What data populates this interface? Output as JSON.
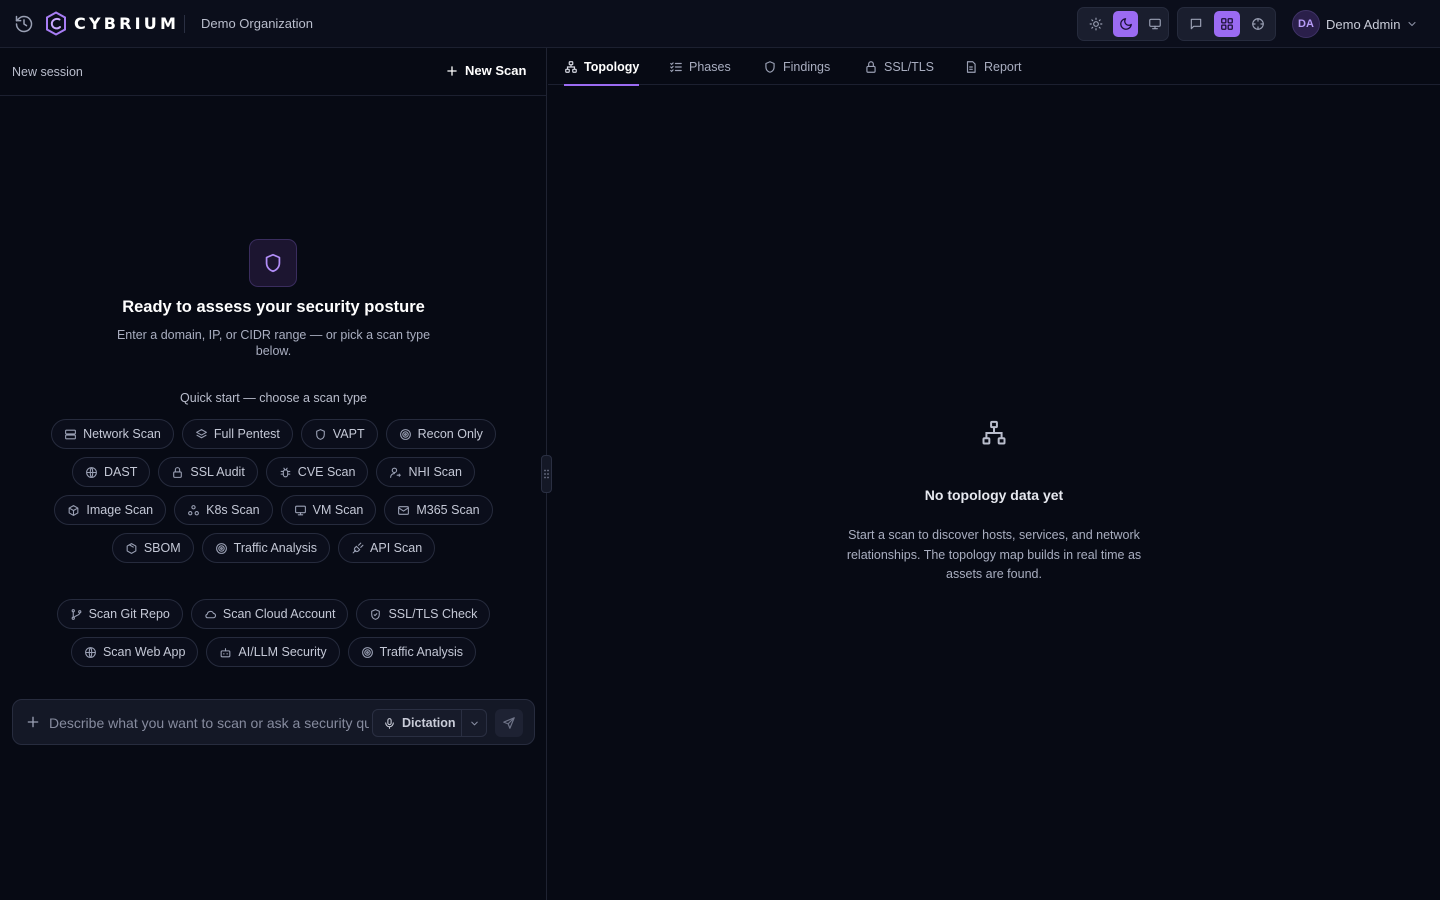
{
  "app": {
    "logo_text": "CYBRIUM",
    "organization": "Demo Organization"
  },
  "colors": {
    "accent": "#9b6bf2",
    "background": "#070a14",
    "panel": "#0b0e1b"
  },
  "header": {
    "history_icon": "history-icon",
    "theme_buttons": [
      {
        "icon": "sun-icon",
        "active": false
      },
      {
        "icon": "moon-icon",
        "active": true
      },
      {
        "icon": "monitor-icon",
        "active": false
      }
    ],
    "view_buttons": [
      {
        "icon": "chat-icon",
        "active": false
      },
      {
        "icon": "grid-icon",
        "active": true
      },
      {
        "icon": "crosshair-icon",
        "active": false
      }
    ],
    "user": {
      "initials": "DA",
      "name": "Demo Admin"
    }
  },
  "session": {
    "label": "New session",
    "new_scan_label": "New Scan"
  },
  "hero": {
    "icon": "shield-icon",
    "title": "Ready to assess your security posture",
    "subtitle": "Enter a domain, IP, or CIDR range — or pick a scan type below."
  },
  "quick_start": {
    "label": "Quick start — choose a scan type",
    "rows": [
      [
        {
          "label": "Network Scan",
          "icon": "server-icon"
        },
        {
          "label": "Full Pentest",
          "icon": "layers-icon"
        },
        {
          "label": "VAPT",
          "icon": "shield-icon"
        },
        {
          "label": "Recon Only",
          "icon": "radar-icon"
        }
      ],
      [
        {
          "label": "DAST",
          "icon": "globe-icon"
        },
        {
          "label": "SSL Audit",
          "icon": "lock-icon"
        },
        {
          "label": "CVE Scan",
          "icon": "bug-icon"
        },
        {
          "label": "NHI Scan",
          "icon": "user-key-icon"
        }
      ],
      [
        {
          "label": "Image Scan",
          "icon": "box-icon"
        },
        {
          "label": "K8s Scan",
          "icon": "cluster-icon"
        },
        {
          "label": "VM Scan",
          "icon": "monitor-icon"
        },
        {
          "label": "M365 Scan",
          "icon": "mail-icon"
        }
      ],
      [
        {
          "label": "SBOM",
          "icon": "package-icon"
        },
        {
          "label": "Traffic Analysis",
          "icon": "radar-icon"
        },
        {
          "label": "API Scan",
          "icon": "plug-icon"
        }
      ]
    ],
    "suggestion_rows": [
      [
        {
          "label": "Scan Git Repo",
          "icon": "git-branch-icon"
        },
        {
          "label": "Scan Cloud Account",
          "icon": "cloud-icon"
        },
        {
          "label": "SSL/TLS Check",
          "icon": "shield-icon"
        }
      ],
      [
        {
          "label": "Scan Web App",
          "icon": "globe-icon"
        },
        {
          "label": "AI/LLM Security",
          "icon": "bot-icon"
        },
        {
          "label": "Traffic Analysis",
          "icon": "radar-icon"
        }
      ]
    ]
  },
  "composer": {
    "placeholder": "Describe what you want to scan or ask a security question...",
    "value": "",
    "dictation_label": "Dictation"
  },
  "tabs": [
    {
      "label": "Topology",
      "icon": "topology-icon",
      "active": true
    },
    {
      "label": "Phases",
      "icon": "list-checks-icon",
      "active": false
    },
    {
      "label": "Findings",
      "icon": "shield-icon",
      "active": false
    },
    {
      "label": "SSL/TLS",
      "icon": "lock-icon",
      "active": false
    },
    {
      "label": "Report",
      "icon": "file-icon",
      "active": false
    }
  ],
  "topology": {
    "icon": "topology-icon",
    "empty_title": "No topology data yet",
    "empty_text": "Start a scan to discover hosts, services, and network relationships. The topology map builds in real time as assets are found."
  }
}
